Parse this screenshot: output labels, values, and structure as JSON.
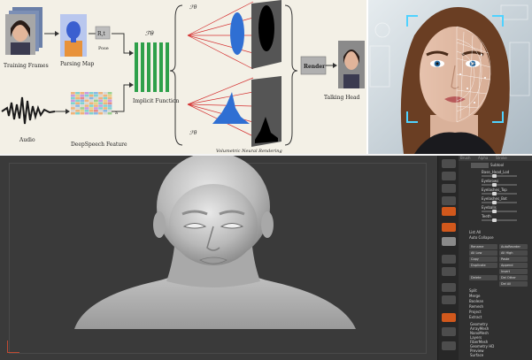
{
  "diagram": {
    "labels": {
      "training_frames": "Training Frames",
      "parsing_map": "Parsing Map",
      "pose_symbol": "R,t",
      "pose": "Pose",
      "f_theta": "ℱθ",
      "implicit_function": "Implicit Function",
      "render": "Render",
      "talking_head": "Talking Head",
      "audio": "Audio",
      "deepspeech_feature": "DeepSpeech Feature",
      "a_t": "a",
      "f_theta_top": "ℱθ",
      "f_theta_bottom": "ℱθ",
      "caption": "Volumetric Neural Rendering"
    },
    "colors": {
      "bg": "#f3f0e6",
      "green": "#2ea04a",
      "blue": "#2f6fd3",
      "red": "#d43030"
    }
  },
  "face_scan": {
    "image_kind": "woman-face-with-biometric-mesh",
    "colors": {
      "accent": "#4fd2ff",
      "bg": "#cfd8de"
    }
  },
  "sculpt": {
    "viewport": {
      "subject": "neutral-head-bust"
    },
    "toolshelf": {
      "labels": [
        "SPix",
        "Floor",
        "Local",
        "Persp",
        "Frame",
        "Move",
        "Scale",
        "Rotate",
        "PolyF",
        "Transp",
        "Solo"
      ]
    },
    "tray": {
      "top_labels": [
        "Brush",
        "Alpha",
        "Stroke",
        "Texture",
        "Material",
        "Color"
      ],
      "subtool_items": [
        "Subtool",
        "Base_Head_Lod",
        "Eyebrows",
        "Eyelashes_Top",
        "Eyelashes_Bot",
        "Eyeballs",
        "Teeth"
      ],
      "controls": {
        "list_all": "List All",
        "auto_collapse": "Auto Collapse",
        "rename": "Rename",
        "auto_reorder": "AutoReorder",
        "all_low": "All Low",
        "all_high": "All High",
        "copy": "Copy",
        "paste": "Paste",
        "duplicate": "Duplicate",
        "append": "Append",
        "insert": "Insert",
        "del_other": "Del Other",
        "delete": "Delete",
        "del_all": "Del All",
        "split": "Split",
        "merge": "Merge",
        "boolean": "Boolean",
        "remesh": "Remesh",
        "project": "Project",
        "extract": "Extract"
      },
      "menu": [
        "Geometry",
        "ArrayMesh",
        "NanoMesh",
        "Layers",
        "FiberMesh",
        "Geometry HD",
        "Preview",
        "Surface",
        "Deformation",
        "Masking",
        "Visibility"
      ]
    }
  }
}
